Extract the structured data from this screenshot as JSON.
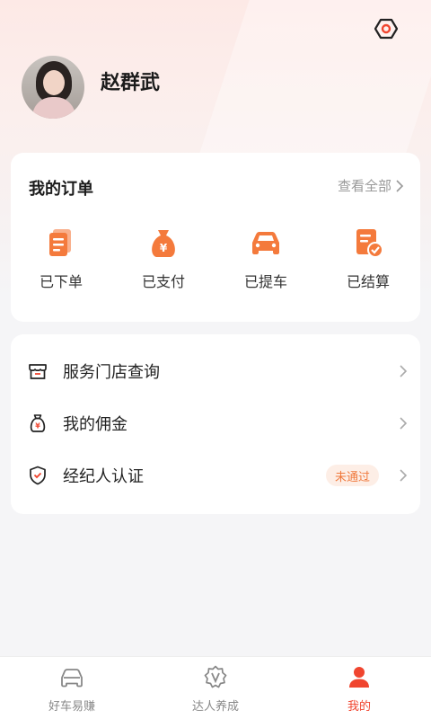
{
  "header": {
    "username": "赵群武",
    "settings_icon": "settings-hex-icon"
  },
  "orders": {
    "title": "我的订单",
    "view_all": "查看全部",
    "items": [
      {
        "label": "已下单",
        "icon": "order-list-icon"
      },
      {
        "label": "已支付",
        "icon": "money-bag-icon"
      },
      {
        "label": "已提车",
        "icon": "car-icon"
      },
      {
        "label": "已结算",
        "icon": "settled-doc-icon"
      }
    ]
  },
  "menu": {
    "items": [
      {
        "label": "服务门店查询",
        "icon": "store-icon"
      },
      {
        "label": "我的佣金",
        "icon": "commission-bag-icon"
      },
      {
        "label": "经纪人认证",
        "icon": "shield-check-icon",
        "badge": "未通过"
      }
    ]
  },
  "tabbar": {
    "items": [
      {
        "label": "好车易赚",
        "icon": "car-outline-icon",
        "active": false
      },
      {
        "label": "达人养成",
        "icon": "v-badge-icon",
        "active": false
      },
      {
        "label": "我的",
        "icon": "person-icon",
        "active": true
      }
    ]
  },
  "colors": {
    "accent": "#f0452f",
    "orange": "#f47a3c",
    "badge_bg": "#fdeee6",
    "badge_text": "#f07a3e"
  }
}
